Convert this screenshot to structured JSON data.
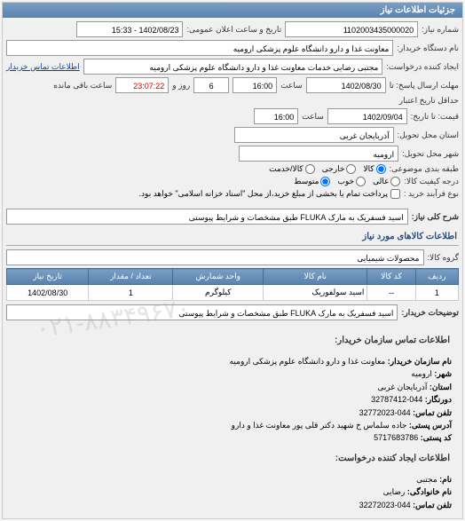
{
  "header": {
    "title": "جزئیات اطلاعات نیاز"
  },
  "fields": {
    "request_no_label": "شماره نیاز:",
    "request_no": "1102003435000020",
    "announce_label": "تاریخ و ساعت اعلان عمومی:",
    "announce_value": "1402/08/23 - 15:33",
    "buyer_label": "نام دستگاه خریدار:",
    "buyer_value": "معاونت غذا و دارو دانشگاه علوم پزشکی ارومیه",
    "creator_label": "ایجاد کننده درخواست:",
    "creator_value": "مجتبی رضایی خدمات معاونت غذا و دارو دانشگاه علوم پزشکی ارومیه",
    "buyer_contact_link": "اطلاعات تماس خریدار",
    "deadline_label": "مهلت ارسال پاسخ: تا",
    "deadline_date": "1402/08/30",
    "time_label": "ساعت",
    "deadline_time": "16:00",
    "days_label": "روز و",
    "days_value": "6",
    "remain_time": "23:07:22",
    "remain_label": "ساعت باقی مانده",
    "validity_label": "حداقل تاریخ اعتبار",
    "validity_from_label": "قیمت: تا تاریخ:",
    "validity_date": "1402/09/04",
    "validity_time": "16:00",
    "delivery_province_label": "استان محل تحویل:",
    "delivery_province": "آذربایجان غربی",
    "delivery_city_label": "شهر محل تحویل:",
    "delivery_city": "ارومیه",
    "group_type_label": "طبقه بندی موضوعی:",
    "priority_label": "درجه کیفیت کالا:",
    "buy_process_label": "نوع فرآیند خرید :",
    "buy_process_note": "پرداخت تمام یا بخشی از مبلغ خرید،از محل \"اسناد خزانه اسلامی\" خواهد بود.",
    "need_title_label": "شرح کلی نیاز:",
    "need_title_value": "اسید فسفریک به مارک FLUKA طبق مشخصات و شرایط پیوستی",
    "goods_section": "اطلاعات کالاهای مورد نیاز",
    "goods_group_label": "گروه کالا:",
    "goods_group_value": "محصولات شیمیایی",
    "buyer_desc_label": "توضیحات خریدار:",
    "buyer_desc_value": "اسید فسفریک به مارک FLUKA طبق مشخصات و شرایط پیوستی"
  },
  "radios": {
    "r_goods": "کالا",
    "r_service": "کالا/خدمت",
    "r_foreign": "خارجی",
    "q_excellent": "عالی",
    "q_good": "خوب",
    "q_medium": "متوسط"
  },
  "table": {
    "h_row": "ردیف",
    "h_code": "کد کالا",
    "h_name": "نام کالا",
    "h_unit": "واحد شمارش",
    "h_qty": "تعداد / مقدار",
    "h_date": "تاریخ نیاز",
    "row1": {
      "idx": "1",
      "code": "--",
      "name": "اسید سولفوریک",
      "unit": "کیلوگرم",
      "qty": "1",
      "date": "1402/08/30"
    }
  },
  "contact": {
    "section1_title": "اطلاعات تماس سازمان خریدار:",
    "org_label": "نام سازمان خریدار:",
    "org_value": "معاونت غذا و دارو دانشگاه علوم پزشکی ارومیه",
    "city_label": "شهر:",
    "city_value": "ارومیه",
    "province_label": "استان:",
    "province_value": "آذربایجان غربی",
    "dvr_label": "دورنگار:",
    "dvr_value": "044-32787412",
    "tel_label": "تلفن تماس:",
    "tel_value": "044-32772023",
    "addr_label": "آدرس پستی:",
    "addr_value": "جاده سلماس خ شهید دکتر قلی پور معاونت غذا و دارو",
    "postal_label": "کد پستی:",
    "postal_value": "5717683786",
    "section2_title": "اطلاعات ایجاد کننده درخواست:",
    "fname_label": "نام:",
    "fname_value": "مجتبی",
    "lname_label": "نام خانوادگی:",
    "lname_value": "رضایی",
    "tel2_label": "تلفن تماس:",
    "tel2_value": "044-32272023"
  },
  "watermark": "۰۲۱-۸۸۳۴۹۶۷۰"
}
